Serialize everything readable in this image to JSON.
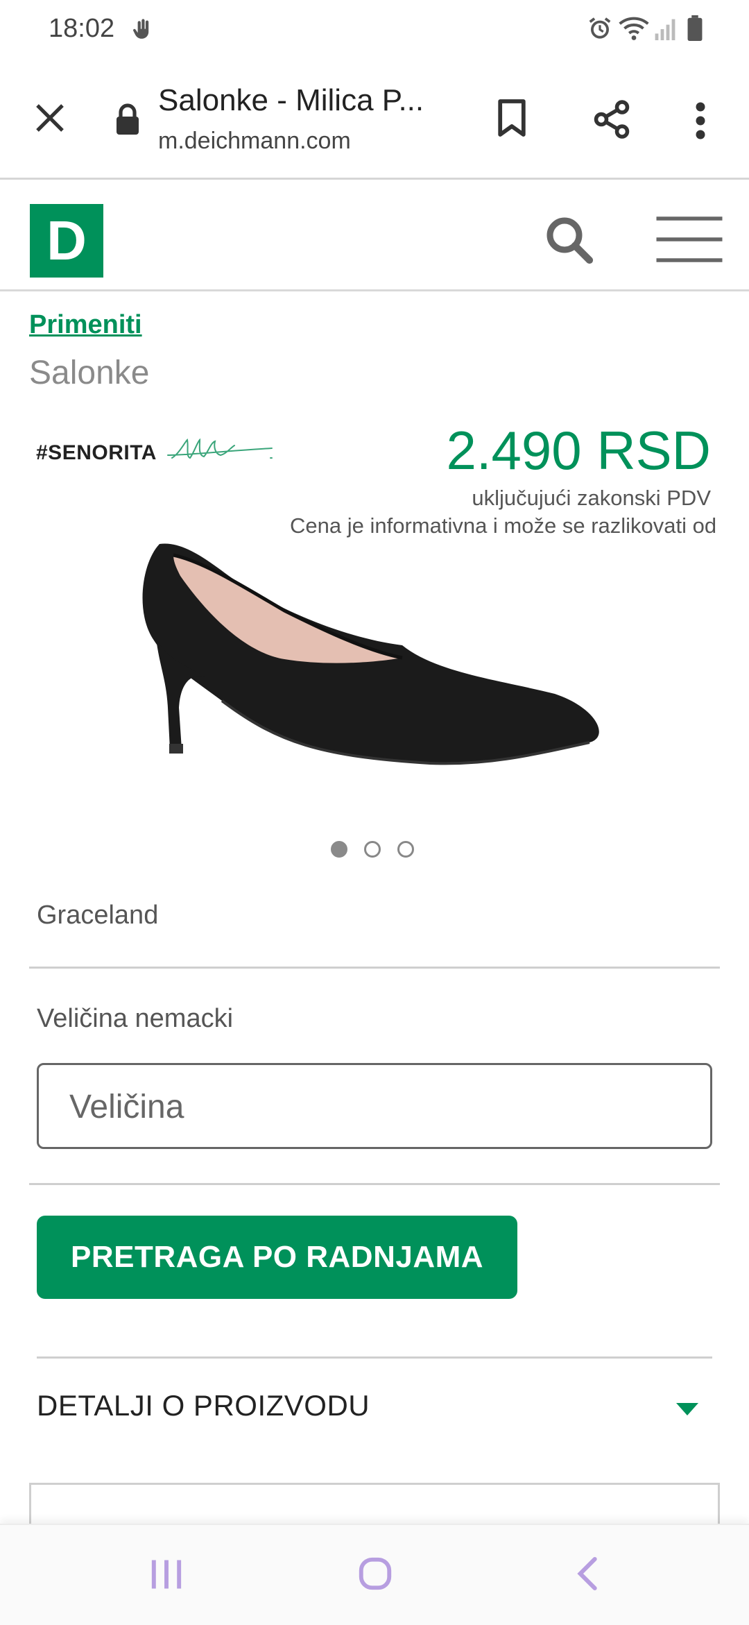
{
  "status_bar": {
    "time": "18:02",
    "icons": [
      "hand-icon",
      "alarm-icon",
      "wifi-icon",
      "signal-icon",
      "battery-icon"
    ]
  },
  "browser": {
    "title": "Salonke - Milica P...",
    "url": "m.deichmann.com",
    "icons": [
      "close-icon",
      "lock-icon",
      "bookmark-icon",
      "share-icon",
      "more-vert-icon"
    ]
  },
  "site_header": {
    "logo_letter": "D",
    "icons": [
      "search-icon",
      "hamburger-menu-icon"
    ]
  },
  "breadcrumb": {
    "link": "Primeniti"
  },
  "category_title": "Salonke",
  "brand_logo": "#SENORITA",
  "price": {
    "amount": "2.490 RSD",
    "vat_note": "uključujući zakonski PDV",
    "info_note": "Cena je informativna i može se razlikovati od"
  },
  "product_image": {
    "subject": "black suede pointed pump high heel",
    "alt_icon": "shoe-image"
  },
  "carousel": {
    "slide_count": 3,
    "active_index": 0
  },
  "product": {
    "brand": "Graceland"
  },
  "size": {
    "label": "Veličina nemacki",
    "placeholder": "Veličina"
  },
  "store_button": {
    "label": "PRETRAGA PO RADNJAMA"
  },
  "details": {
    "title": "DETALJI O PROIZVODU"
  },
  "colors": {
    "brand_green": "#00915a",
    "text_grey": "#555555",
    "nav_icon": "#b79ee0"
  },
  "nav_bar": {
    "icons": [
      "recent-apps-icon",
      "home-icon",
      "back-icon"
    ]
  }
}
